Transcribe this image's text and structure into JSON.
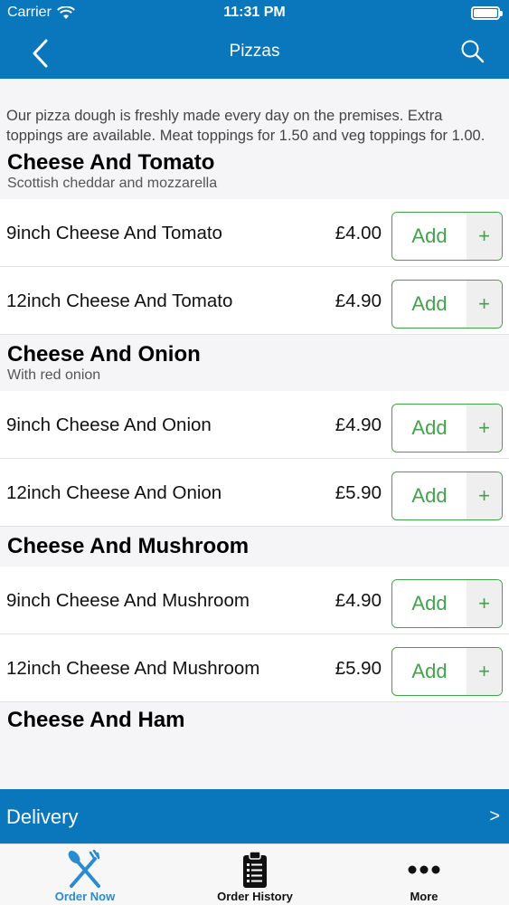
{
  "status_bar": {
    "carrier": "Carrier",
    "time": "11:31 PM"
  },
  "nav": {
    "title": "Pizzas"
  },
  "intro": "Our pizza dough is freshly made every day on the premises. Extra toppings are available. Meat toppings for 1.50 and veg toppings for 1.00.",
  "sections": [
    {
      "title": "Cheese And Tomato",
      "subtitle": "Scottish cheddar and mozzarella",
      "items": [
        {
          "name": "9inch Cheese And Tomato",
          "price": "£4.00"
        },
        {
          "name": "12inch Cheese And Tomato",
          "price": "£4.90"
        }
      ]
    },
    {
      "title": "Cheese And Onion",
      "subtitle": "With red onion",
      "items": [
        {
          "name": "9inch Cheese And Onion",
          "price": "£4.90"
        },
        {
          "name": "12inch Cheese And Onion",
          "price": "£5.90"
        }
      ]
    },
    {
      "title": "Cheese And Mushroom",
      "items": [
        {
          "name": "9inch Cheese And Mushroom",
          "price": "£4.90"
        },
        {
          "name": "12inch Cheese And Mushroom",
          "price": "£5.90"
        }
      ]
    },
    {
      "title": "Cheese And Ham"
    }
  ],
  "button": {
    "add_label": "Add",
    "plus_label": "+"
  },
  "delivery": {
    "label": "Delivery",
    "arrow": ">"
  },
  "tabs": [
    {
      "label": "Order Now",
      "icon": "fork-knife-icon",
      "active": true
    },
    {
      "label": "Order History",
      "icon": "clipboard-icon",
      "active": false
    },
    {
      "label": "More",
      "icon": "more-dots-icon",
      "active": false
    }
  ],
  "colors": {
    "brand": "#0a77bd",
    "add_green": "#42a34a",
    "active_tab": "#2a8bd0"
  }
}
